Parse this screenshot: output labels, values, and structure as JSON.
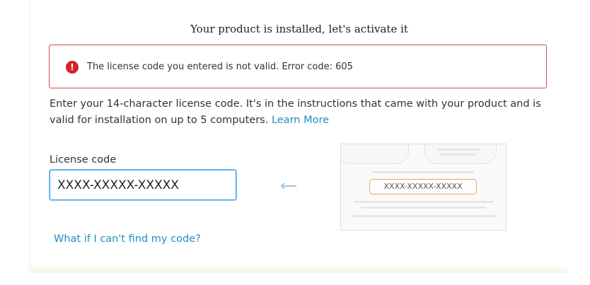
{
  "page": {
    "title": "Your product is installed, let's activate it"
  },
  "error": {
    "icon": "exclamation-circle-icon",
    "icon_glyph": "!",
    "message": "The license code you entered is not valid. Error code: 605",
    "color": "#d8222a"
  },
  "instructions": {
    "text": "Enter your 14-character license code. It's in the instructions that came with your product and is valid for installation on up to 5 computers. ",
    "learn_more_label": "Learn More"
  },
  "license": {
    "label": "License code",
    "value": "XXXX-XXXXX-XXXXX"
  },
  "sample": {
    "arrow_icon": "arrow-left-icon",
    "code": "XXXX-XXXXX-XXXXX"
  },
  "help": {
    "link_label": "What if I can't find my code?"
  },
  "colors": {
    "accent": "#1f8fbf",
    "input_focus": "#3fa1e6",
    "error_border": "#d24b4b"
  }
}
